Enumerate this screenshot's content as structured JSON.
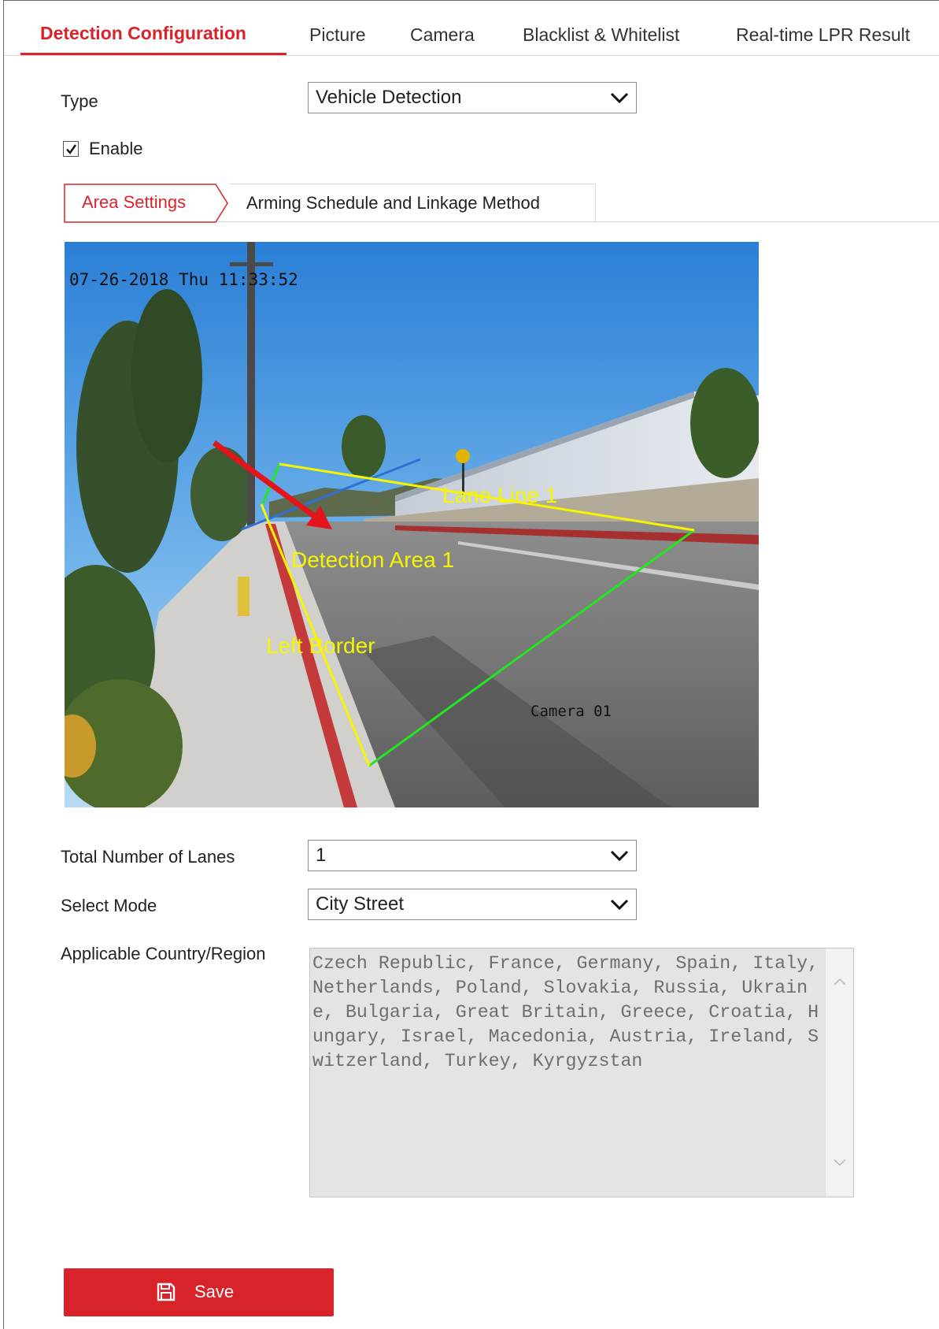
{
  "tabs": {
    "detection_configuration": "Detection Configuration",
    "picture": "Picture",
    "camera": "Camera",
    "blacklist_whitelist": "Blacklist & Whitelist",
    "realtime_lpr": "Real-time LPR Result"
  },
  "form": {
    "type_label": "Type",
    "type_value": "Vehicle Detection",
    "enable_label": "Enable",
    "enable_checked": true,
    "lanes_label": "Total Number of Lanes",
    "lanes_value": "1",
    "mode_label": "Select Mode",
    "mode_value": "City Street",
    "country_label": "Applicable Country/Region",
    "country_value": "Czech Republic, France, Germany, Spain, Italy, Netherlands, Poland, Slovakia, Russia, Ukraine, Bulgaria, Great Britain, Greece, Croatia, Hungary, Israel, Macedonia, Austria, Ireland, Switzerland, Turkey, Kyrgyzstan"
  },
  "subtabs": {
    "area_settings": "Area Settings",
    "arming_schedule": "Arming Schedule and Linkage Method"
  },
  "video": {
    "timestamp": "07-26-2018 Thu 11:33:52",
    "camera_name": "Camera 01",
    "labels": {
      "lane_line": "Lane Line 1",
      "detection_area": "Detection Area 1",
      "left_border": "Left Border"
    },
    "colors": {
      "lane_line": "#f5f500",
      "left_border": "#f5f500",
      "detection_area_right": "#22e61e",
      "blue_line": "#2f6fd6",
      "direction_arrow": "#e3141b"
    }
  },
  "buttons": {
    "save": "Save"
  },
  "colors": {
    "accent": "#d8232a"
  }
}
